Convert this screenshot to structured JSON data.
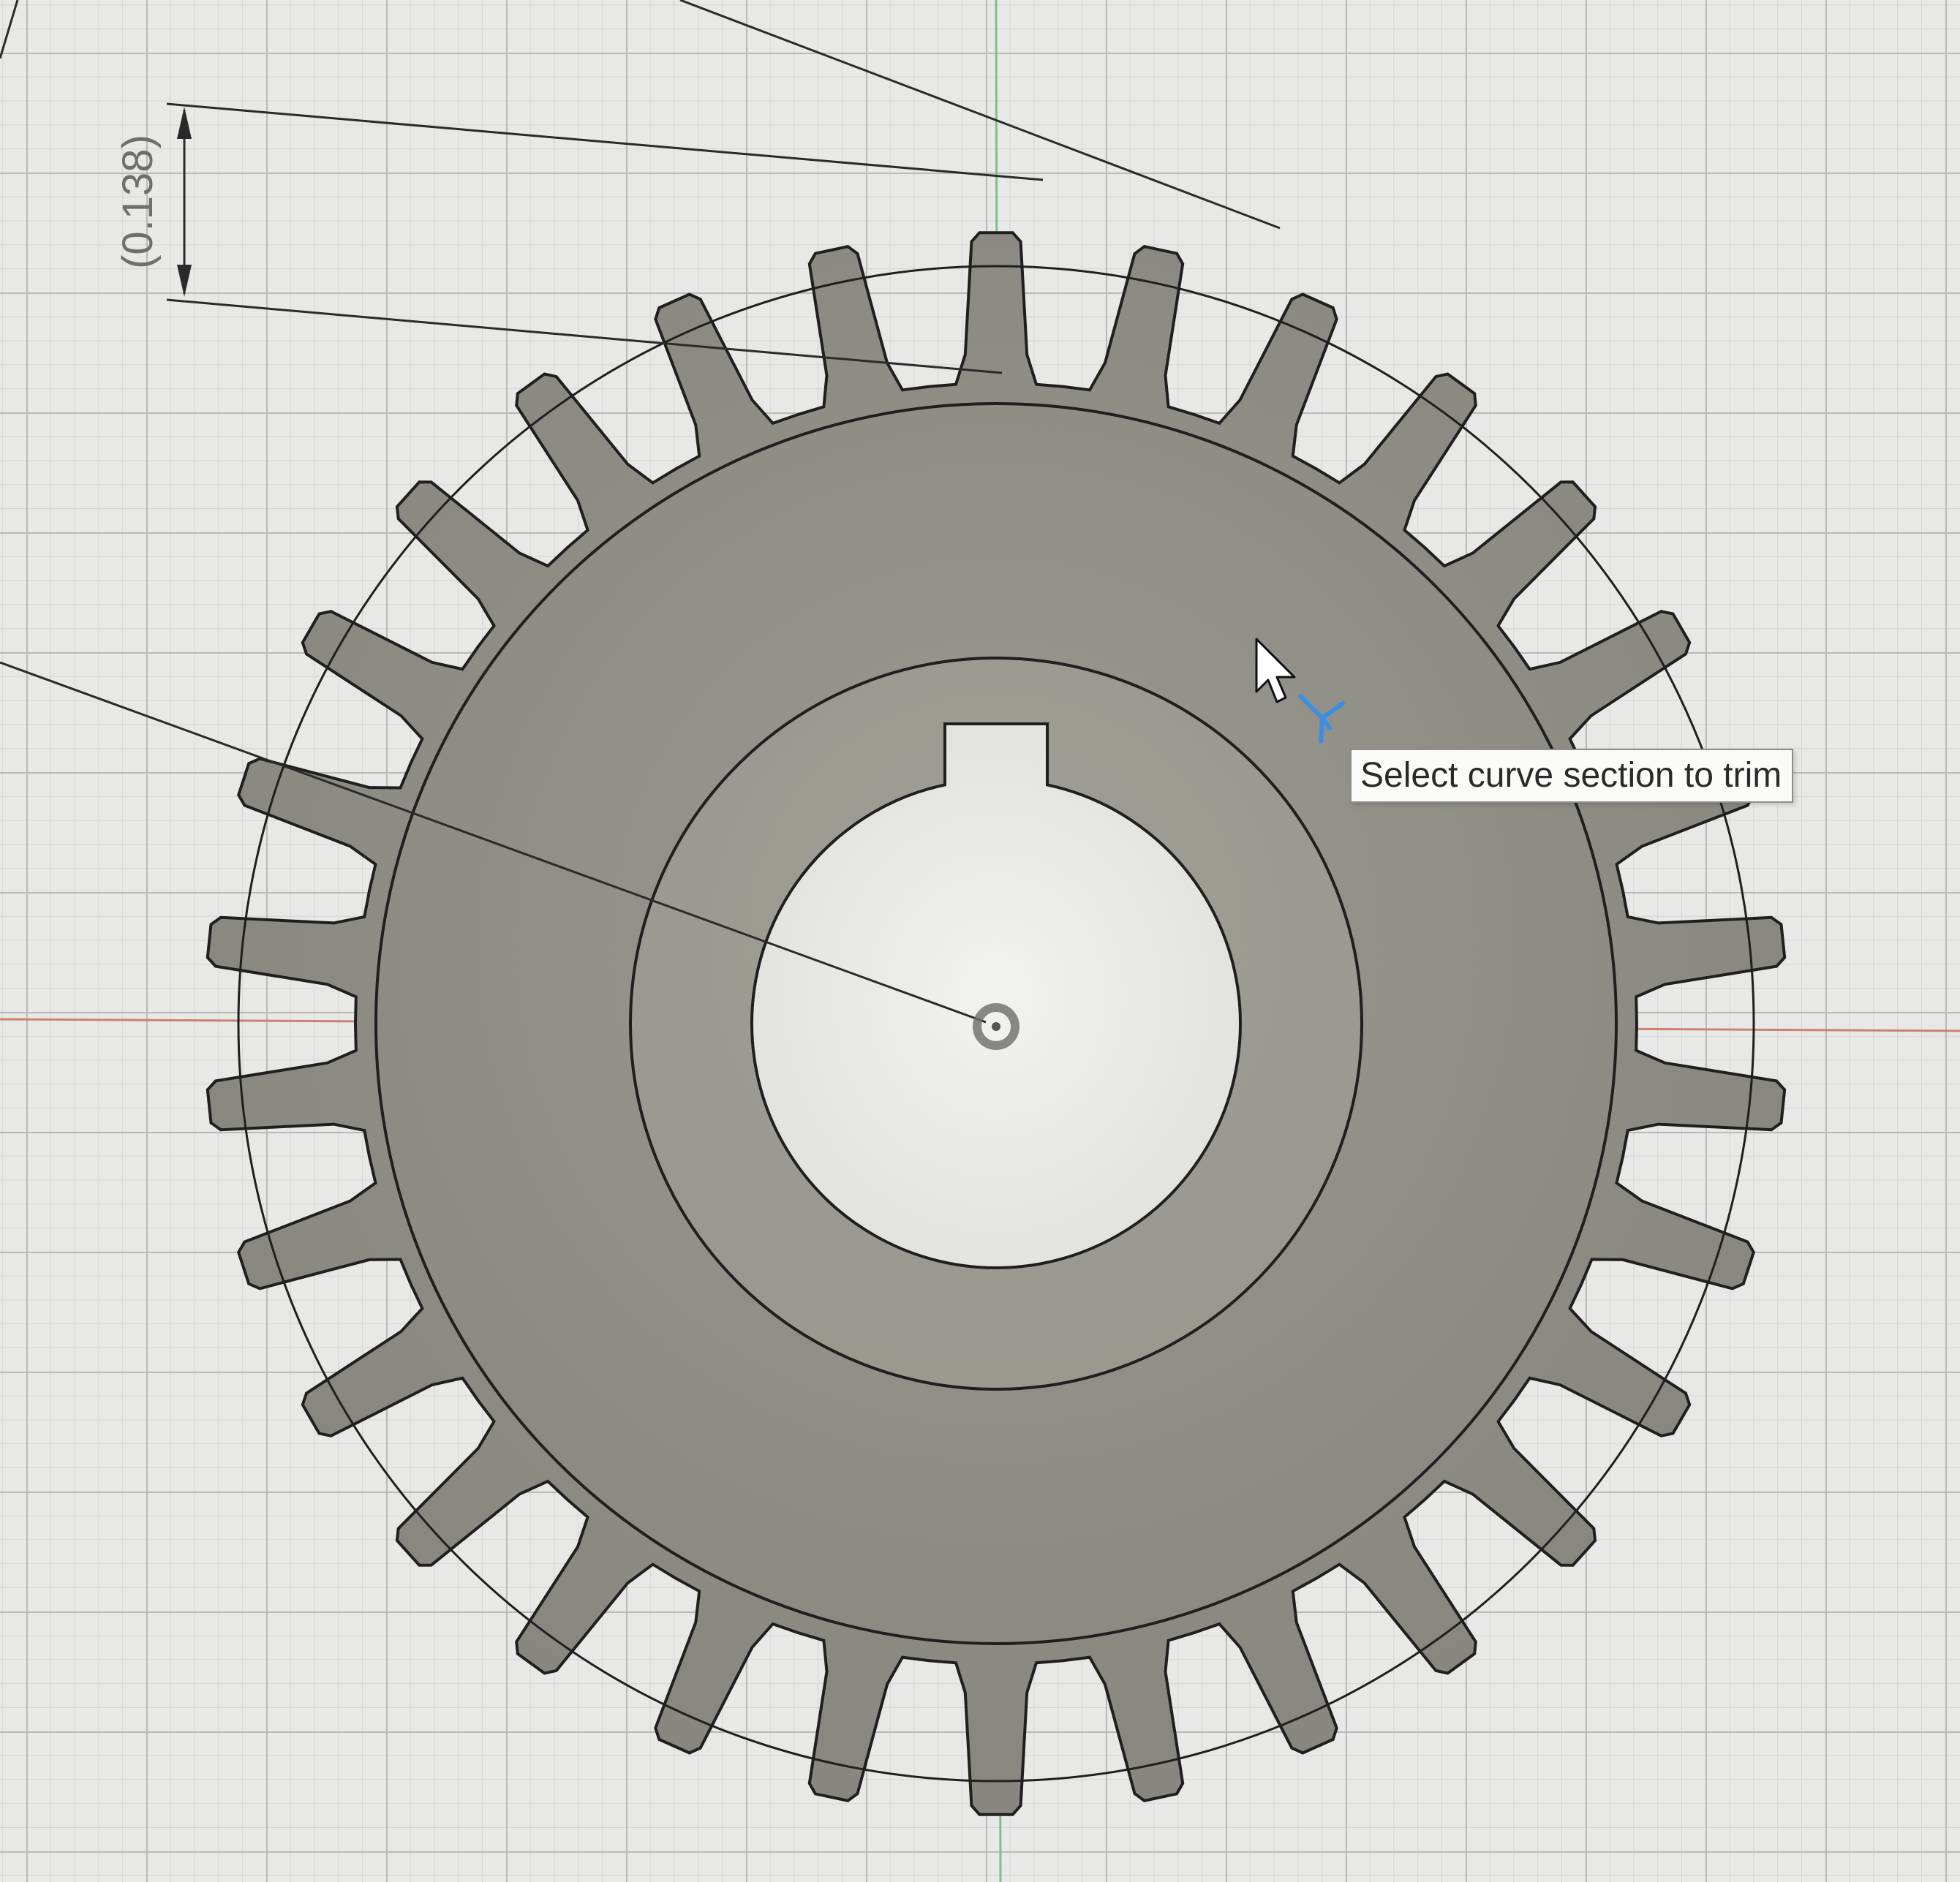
{
  "app": {
    "workspace": "sketch",
    "active_tool": "trim"
  },
  "dimension": {
    "label": "(0.138)"
  },
  "tooltip": {
    "text": "Select curve section to trim"
  },
  "gear": {
    "tooth_count": 30,
    "has_keyway": true
  },
  "colors": {
    "grid_background": "#e8e9e7",
    "gear_fill": "#8c8c84",
    "sketch_line": "#1f1f1f",
    "x_axis": "#c9836f",
    "y_axis": "#7fc08a",
    "cursor_accent": "#3b8ee0"
  },
  "cursor": {
    "icon": "arrow-cursor-icon",
    "tool_icon": "trim-tool-icon"
  }
}
